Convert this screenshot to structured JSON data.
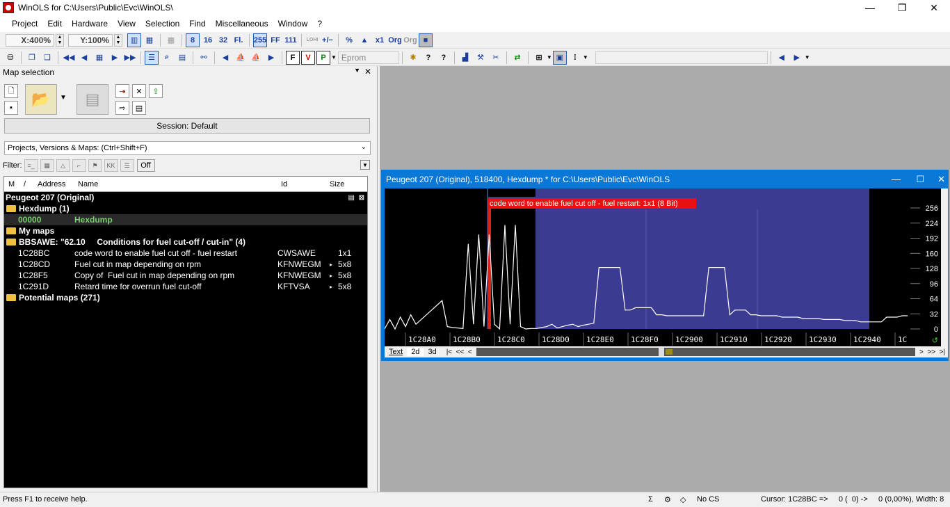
{
  "window": {
    "title": "WinOLS for C:\\Users\\Public\\Evc\\WinOLS\\",
    "minimize": "—",
    "maximize": "❐",
    "close": "✕"
  },
  "menu": [
    "Project",
    "Edit",
    "Hardware",
    "View",
    "Selection",
    "Find",
    "Miscellaneous",
    "Window",
    "?"
  ],
  "toolbar": {
    "zoom_x": "X:400%",
    "zoom_y": "Y:100%",
    "btn_8": "8",
    "btn_16": "16",
    "btn_32": "32",
    "btn_fl": "Fl.",
    "btn_255": "255",
    "btn_ff": "FF",
    "btn_111": "111",
    "btn_lohi": "LOHI",
    "btn_pct": "%",
    "btn_x1": "x1",
    "btn_org": "Org",
    "btn_org2": "Org",
    "eprom": "Eprom"
  },
  "map_selection": {
    "title": "Map selection",
    "session": "Session: Default",
    "projects_dropdown": "Projects, Versions & Maps:  (Ctrl+Shift+F)",
    "filter_label": "Filter:",
    "filter_off": "Off",
    "columns": {
      "m": "M",
      "slash": "/",
      "address": "Address",
      "name": "Name",
      "id": "Id",
      "size": "Size"
    },
    "project_name": "Peugeot 207 (Original)",
    "groups": {
      "hexdump": "Hexdump (1)",
      "hexdump_addr": "00000",
      "hexdump_name": "Hexdump",
      "my_maps": "My maps",
      "bbsawe": "BBSAWE: \"62.10     Conditions for fuel cut-off / cut-in\" (4)",
      "potential": "Potential maps (271)"
    },
    "rows": [
      {
        "address": "1C28BC",
        "name": "code word to enable fuel cut off - fuel restart",
        "id": "CWSAWE",
        "mark": "",
        "size": "1x1"
      },
      {
        "address": "1C28CD",
        "name": "Fuel cut in map depending on rpm",
        "id": "KFNWEGM",
        "mark": "▸",
        "size": "5x8"
      },
      {
        "address": "1C28F5",
        "name": "Copy of  Fuel cut in map depending on rpm",
        "id": "KFNWEGM",
        "mark": "▸",
        "size": "5x8"
      },
      {
        "address": "1C291D",
        "name": "Retard time for overrun fuel cut-off",
        "id": "KFTVSA",
        "mark": "▸",
        "size": "5x8"
      }
    ]
  },
  "hexwin": {
    "title": "Peugeot 207 (Original), 518400, Hexdump * for C:\\Users\\Public\\Evc\\WinOLS",
    "tooltip": "code word to enable fuel cut off - fuel restart: 1x1 (8 Bit)",
    "tabs": [
      "Text",
      "2d",
      "3d"
    ],
    "nav_left": "|<  <<  <",
    "nav_right": ">  >>  >|"
  },
  "chart_data": {
    "type": "line",
    "x_labels": [
      "1C28A0",
      "1C28B0",
      "1C28C0",
      "1C28D0",
      "1C28E0",
      "1C28F0",
      "1C2900",
      "1C2910",
      "1C2920",
      "1C2930",
      "1C2940",
      "1C"
    ],
    "y_ticks": [
      0,
      32,
      64,
      96,
      128,
      160,
      192,
      224,
      256
    ],
    "ylim": [
      0,
      256
    ],
    "series": [
      {
        "values": [
          0,
          20,
          0,
          25,
          5,
          30,
          10,
          20,
          30,
          40,
          50,
          60,
          5,
          3,
          2,
          1,
          180,
          10,
          200,
          5,
          200,
          10,
          0,
          220,
          10,
          220,
          5,
          0,
          1,
          1,
          3,
          5,
          10,
          2,
          5,
          8,
          10,
          5,
          8,
          10,
          12,
          130,
          130,
          130,
          130,
          130,
          40,
          40,
          45,
          45,
          45,
          45,
          30,
          30,
          28,
          28,
          28,
          28,
          28,
          28,
          28,
          28,
          130,
          130,
          130,
          130,
          30,
          40,
          40,
          40,
          30,
          30,
          28,
          28,
          28,
          28,
          25,
          25,
          25,
          25,
          22,
          22,
          22,
          22,
          20,
          20,
          20,
          20,
          18,
          18,
          18,
          15,
          15,
          15,
          15,
          15,
          25,
          25,
          25,
          28,
          28
        ]
      }
    ]
  },
  "statusbar": {
    "help": "Press F1 to receive help.",
    "cs": "No CS",
    "cursor": "Cursor: 1C28BC =>     0 (  0) ->     0 (0,00%), Width: 8"
  }
}
